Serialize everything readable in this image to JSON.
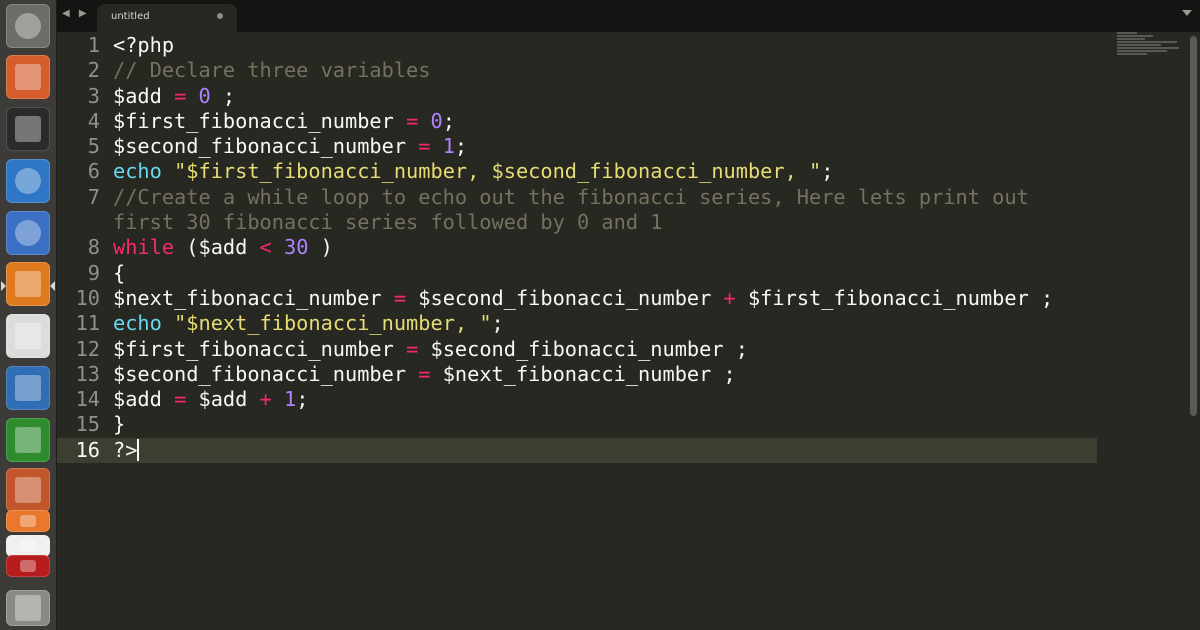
{
  "launcher": {
    "items": [
      {
        "name": "dash-home",
        "icon": "ubuntu-logo-icon",
        "color": "#6d6d68"
      },
      {
        "name": "files",
        "icon": "file-cabinet-icon",
        "color": "#d55d2c"
      },
      {
        "name": "terminal",
        "icon": "terminal-icon",
        "color": "#2b2b2b"
      },
      {
        "name": "chrome",
        "icon": "chrome-icon",
        "color": "#2f77c6"
      },
      {
        "name": "firefox",
        "icon": "firefox-icon",
        "color": "#3a6fc4"
      },
      {
        "name": "sublime-text",
        "icon": "sublime-text-icon",
        "color": "#e07a1f"
      },
      {
        "name": "text-editor",
        "icon": "notepad-icon",
        "color": "#dcdcdc"
      },
      {
        "name": "writer",
        "icon": "writer-document-icon",
        "color": "#2f6db5"
      },
      {
        "name": "calc",
        "icon": "calc-spreadsheet-icon",
        "color": "#2e8b2e"
      },
      {
        "name": "impress",
        "icon": "impress-presentation-icon",
        "color": "#c0562a"
      },
      {
        "name": "software-center",
        "icon": "shopping-bag-icon",
        "color": "#e9782c"
      },
      {
        "name": "amazon",
        "icon": "amazon-icon",
        "color": "#f0f0f0"
      },
      {
        "name": "filezilla",
        "icon": "filezilla-icon",
        "color": "#b71c1c"
      },
      {
        "name": "workspaces",
        "icon": "workspace-switcher-icon",
        "color": "#8a8a85"
      }
    ]
  },
  "tabbar": {
    "back": "◀",
    "forward": "▶",
    "tab_title": "untitled"
  },
  "editor": {
    "lines": [
      {
        "no": "1",
        "tokens": [
          {
            "t": "<?php",
            "c": ""
          }
        ]
      },
      {
        "no": "2",
        "tokens": [
          {
            "t": "// Declare three variables",
            "c": "c-comment"
          }
        ]
      },
      {
        "no": "3",
        "tokens": [
          {
            "t": "$add ",
            "c": ""
          },
          {
            "t": "=",
            "c": "c-op"
          },
          {
            "t": " ",
            "c": ""
          },
          {
            "t": "0",
            "c": "c-num"
          },
          {
            "t": " ;",
            "c": ""
          }
        ]
      },
      {
        "no": "4",
        "tokens": [
          {
            "t": "$first_fibonacci_number ",
            "c": ""
          },
          {
            "t": "=",
            "c": "c-op"
          },
          {
            "t": " ",
            "c": ""
          },
          {
            "t": "0",
            "c": "c-num"
          },
          {
            "t": ";",
            "c": ""
          }
        ]
      },
      {
        "no": "5",
        "tokens": [
          {
            "t": "$second_fibonacci_number ",
            "c": ""
          },
          {
            "t": "=",
            "c": "c-op"
          },
          {
            "t": " ",
            "c": ""
          },
          {
            "t": "1",
            "c": "c-num"
          },
          {
            "t": ";",
            "c": ""
          }
        ]
      },
      {
        "no": "6",
        "tokens": [
          {
            "t": "echo",
            "c": "c-kw"
          },
          {
            "t": " ",
            "c": ""
          },
          {
            "t": "\"$first_fibonacci_number, $second_fibonacci_number, \"",
            "c": "c-str"
          },
          {
            "t": ";",
            "c": ""
          }
        ]
      },
      {
        "no": "7",
        "tokens": [
          {
            "t": "//Create a while loop to echo out the fibonacci series, Here lets print out",
            "c": "c-comment"
          }
        ]
      },
      {
        "no": "",
        "tokens": [
          {
            "t": "first 30 fibonacci series followed by 0 and 1",
            "c": "c-comment"
          }
        ]
      },
      {
        "no": "8",
        "tokens": [
          {
            "t": "while",
            "c": "c-ctl"
          },
          {
            "t": " ($add ",
            "c": ""
          },
          {
            "t": "<",
            "c": "c-op"
          },
          {
            "t": " ",
            "c": ""
          },
          {
            "t": "30",
            "c": "c-num"
          },
          {
            "t": " )",
            "c": ""
          }
        ]
      },
      {
        "no": "9",
        "tokens": [
          {
            "t": "{",
            "c": ""
          }
        ]
      },
      {
        "no": "10",
        "tokens": [
          {
            "t": "$next_fibonacci_number ",
            "c": ""
          },
          {
            "t": "=",
            "c": "c-op"
          },
          {
            "t": " $second_fibonacci_number ",
            "c": ""
          },
          {
            "t": "+",
            "c": "c-op"
          },
          {
            "t": " $first_fibonacci_number ;",
            "c": ""
          }
        ]
      },
      {
        "no": "11",
        "tokens": [
          {
            "t": "echo",
            "c": "c-kw"
          },
          {
            "t": " ",
            "c": ""
          },
          {
            "t": "\"$next_fibonacci_number, \"",
            "c": "c-str"
          },
          {
            "t": ";",
            "c": ""
          }
        ]
      },
      {
        "no": "12",
        "tokens": [
          {
            "t": "$first_fibonacci_number ",
            "c": ""
          },
          {
            "t": "=",
            "c": "c-op"
          },
          {
            "t": " $second_fibonacci_number ;",
            "c": ""
          }
        ]
      },
      {
        "no": "13",
        "tokens": [
          {
            "t": "$second_fibonacci_number ",
            "c": ""
          },
          {
            "t": "=",
            "c": "c-op"
          },
          {
            "t": " $next_fibonacci_number ;",
            "c": ""
          }
        ]
      },
      {
        "no": "14",
        "tokens": [
          {
            "t": "$add ",
            "c": ""
          },
          {
            "t": "=",
            "c": "c-op"
          },
          {
            "t": " $add ",
            "c": ""
          },
          {
            "t": "+",
            "c": "c-op"
          },
          {
            "t": " ",
            "c": ""
          },
          {
            "t": "1",
            "c": "c-num"
          },
          {
            "t": ";",
            "c": ""
          }
        ]
      },
      {
        "no": "15",
        "tokens": [
          {
            "t": "}",
            "c": ""
          }
        ]
      },
      {
        "no": "16",
        "tokens": [
          {
            "t": "?>",
            "c": ""
          }
        ],
        "active": true,
        "cursor": true
      }
    ]
  }
}
